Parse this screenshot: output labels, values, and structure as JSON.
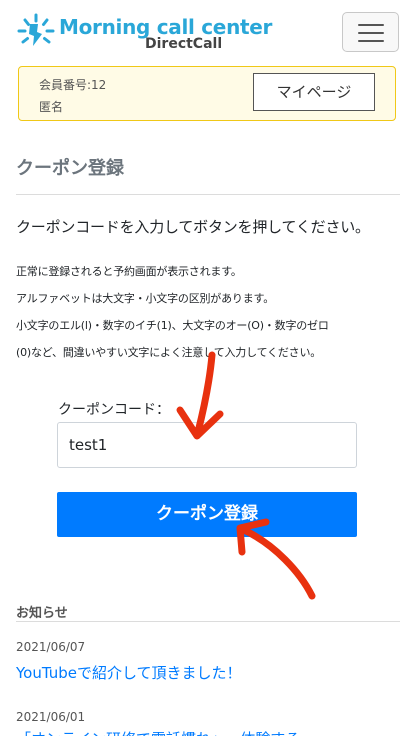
{
  "header": {
    "brand_title": "Morning call center",
    "brand_sub": "DirectCall",
    "menu_icon": "hamburger-menu-icon",
    "logo_icon": "sunrise-logo-icon",
    "brand_color": "#2aa7d8"
  },
  "member": {
    "number_label": "会員番号:12",
    "name": "匿名",
    "mypage_label": "マイページ"
  },
  "page": {
    "title": "クーポン登録",
    "lead": "クーポンコードを入力してボタンを押してください。",
    "notes": [
      "正常に登録されると予約画面が表示されます。",
      "アルファベットは大文字・小文字の区別があります。",
      "小文字のエル(l)・数字のイチ(1)、大文字のオー(O)・数字のゼロ",
      "(0)など、間違いやすい文字によく注意して入力してください。"
    ]
  },
  "form": {
    "code_label": "クーポンコード：",
    "code_value": "test1",
    "submit_label": "クーポン登録",
    "submit_color": "#007bff"
  },
  "news": {
    "heading": "お知らせ",
    "items": [
      {
        "date": "2021/06/07",
        "title": "YouTubeで紹介して頂きました！"
      },
      {
        "date": "2021/06/01",
        "title": "「オンライン研修で電話慣れ」...体験する"
      }
    ]
  },
  "annotations": {
    "arrow_color": "#e8310f",
    "arrow_icon": "red-hand-drawn-arrow-icon"
  }
}
